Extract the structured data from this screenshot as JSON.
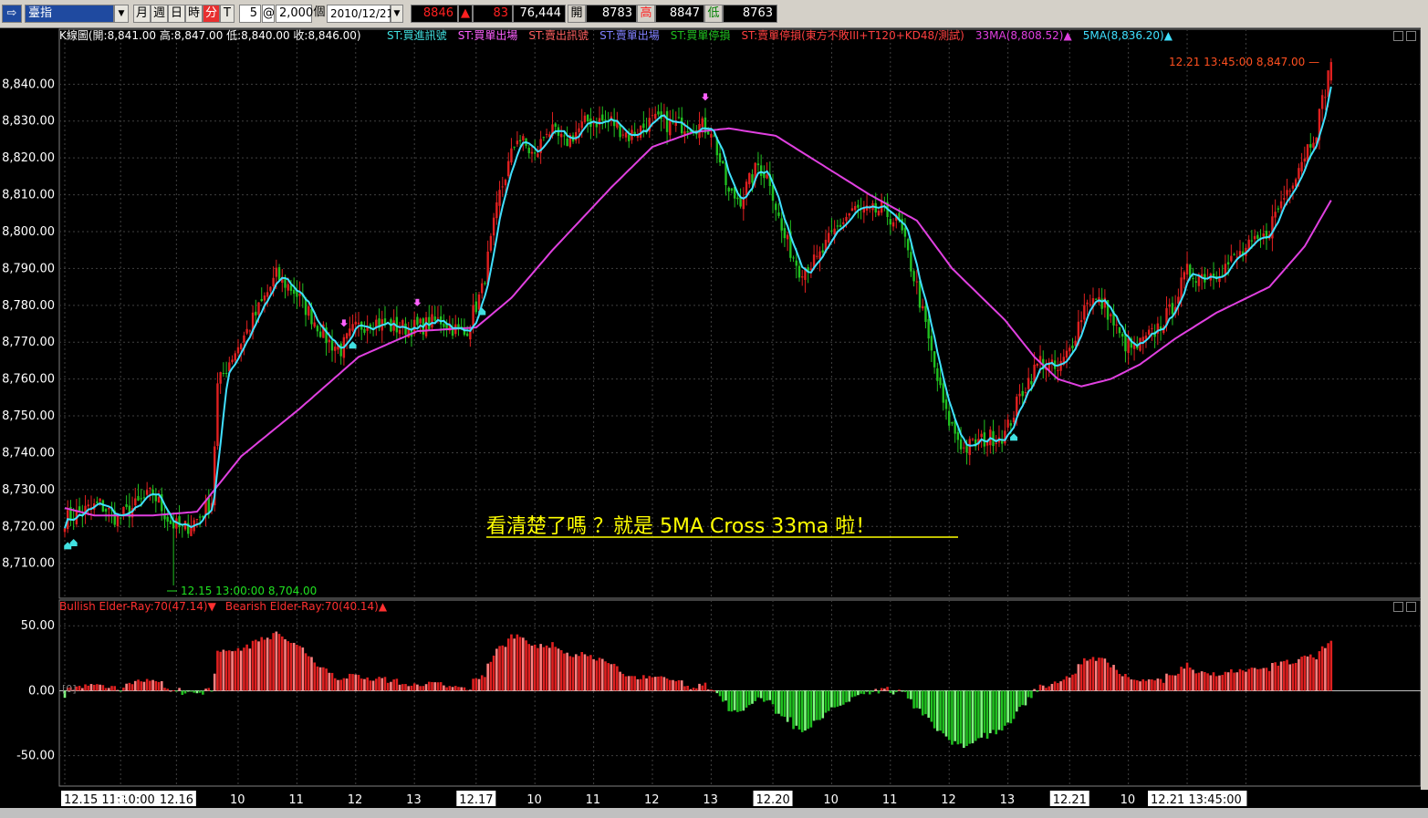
{
  "toolbar": {
    "symbol": "臺指",
    "periods": [
      "月",
      "週",
      "日",
      "時",
      "分",
      "T"
    ],
    "interval": "5",
    "at": "@",
    "qty": "2,000",
    "qty_unit": "個",
    "date": "2010/12/21",
    "last": "8846",
    "change_arrow": "▲",
    "change": "83",
    "volume": "76,444",
    "open_label": "開",
    "open": "8783",
    "high_label": "高",
    "high": "8847",
    "low_label": "低",
    "low": "8763"
  },
  "legend": {
    "kline": "K線圖(開:8,841.00 高:8,847.00 低:8,840.00 收:8,846.00)",
    "items": [
      {
        "text": "ST:買進訊號",
        "color": "#40e0e0"
      },
      {
        "text": "ST:買單出場",
        "color": "#ff60ff"
      },
      {
        "text": "ST:賣出訊號",
        "color": "#ff6060"
      },
      {
        "text": "ST:賣單出場",
        "color": "#8080ff"
      },
      {
        "text": "ST:買單停損",
        "color": "#20c020"
      },
      {
        "text": "ST:賣單停損(東方不敗III+T120+KD48/測試)",
        "color": "#ff4040"
      },
      {
        "text": "33MA(8,808.52)▲",
        "color": "#e040e0"
      },
      {
        "text": "5MA(8,836.20)▲",
        "color": "#40e0ff"
      }
    ],
    "sub": [
      {
        "text": "Bullish Elder-Ray:70(47.14)▼",
        "color": "#ff3030"
      },
      {
        "text": "Bearish Elder-Ray:70(40.14)▲",
        "color": "#ff3030"
      }
    ],
    "zero_marker": "[0]"
  },
  "annotations": {
    "high_label": "12.21 13:45:00  8,847.00 —",
    "low_label": "12.15 13:00:00  8,704.00",
    "caption": "看清楚了嗎 ？就是  5MA Cross 33ma 啦！"
  },
  "colors": {
    "up": "#e02020",
    "down": "#20c020",
    "ma33": "#e040e0",
    "ma5": "#40e0ff",
    "grid": "#404040",
    "caption": "#ffff00"
  },
  "chart_data": {
    "type": "candlestick",
    "y_axis": {
      "range": [
        8703,
        8848
      ],
      "ticks": [
        "8,710.00",
        "8,720.00",
        "8,730.00",
        "8,740.00",
        "8,750.00",
        "8,760.00",
        "8,770.00",
        "8,780.00",
        "8,790.00",
        "8,800.00",
        "8,810.00",
        "8,820.00",
        "8,830.00",
        "8,840.00"
      ],
      "tick_values": [
        8710,
        8720,
        8730,
        8740,
        8750,
        8760,
        8770,
        8780,
        8790,
        8800,
        8810,
        8820,
        8830,
        8840
      ]
    },
    "x_axis": {
      "labels": [
        "12.15 11:10:00",
        "13",
        "12.16",
        "10",
        "11",
        "12",
        "13",
        "12.17",
        "10",
        "11",
        "12",
        "13",
        "12.20",
        "10",
        "11",
        "12",
        "13",
        "12.21",
        "10",
        "11",
        "12.21 13:45:00"
      ],
      "label_index": [
        0,
        19,
        38,
        59,
        79,
        99,
        119,
        140,
        160,
        180,
        200,
        220,
        241,
        261,
        281,
        301,
        321,
        342,
        362,
        382,
        402
      ]
    },
    "anchors_close": [
      [
        0,
        8722
      ],
      [
        12,
        8726
      ],
      [
        18,
        8722
      ],
      [
        30,
        8729
      ],
      [
        36,
        8721
      ],
      [
        40,
        8719
      ],
      [
        45,
        8722
      ],
      [
        50,
        8727
      ],
      [
        52,
        8758
      ],
      [
        56,
        8765
      ],
      [
        62,
        8773
      ],
      [
        72,
        8788
      ],
      [
        78,
        8784
      ],
      [
        90,
        8770
      ],
      [
        94,
        8768
      ],
      [
        98,
        8773
      ],
      [
        104,
        8776
      ],
      [
        112,
        8774
      ],
      [
        120,
        8774
      ],
      [
        128,
        8776
      ],
      [
        136,
        8772
      ],
      [
        142,
        8784
      ],
      [
        148,
        8810
      ],
      [
        154,
        8826
      ],
      [
        160,
        8820
      ],
      [
        164,
        8828
      ],
      [
        170,
        8824
      ],
      [
        178,
        8830
      ],
      [
        186,
        8830
      ],
      [
        192,
        8826
      ],
      [
        200,
        8830
      ],
      [
        208,
        8829
      ],
      [
        214,
        8829
      ],
      [
        220,
        8828
      ],
      [
        226,
        8810
      ],
      [
        230,
        8809
      ],
      [
        236,
        8818
      ],
      [
        240,
        8814
      ],
      [
        244,
        8800
      ],
      [
        250,
        8790
      ],
      [
        256,
        8792
      ],
      [
        262,
        8800
      ],
      [
        268,
        8806
      ],
      [
        274,
        8805
      ],
      [
        278,
        8806
      ],
      [
        284,
        8802
      ],
      [
        290,
        8785
      ],
      [
        296,
        8763
      ],
      [
        300,
        8750
      ],
      [
        306,
        8741
      ],
      [
        314,
        8744
      ],
      [
        320,
        8745
      ],
      [
        326,
        8757
      ],
      [
        332,
        8765
      ],
      [
        338,
        8762
      ],
      [
        342,
        8768
      ],
      [
        348,
        8782
      ],
      [
        354,
        8780
      ],
      [
        360,
        8770
      ],
      [
        364,
        8768
      ],
      [
        370,
        8772
      ],
      [
        376,
        8778
      ],
      [
        382,
        8789
      ],
      [
        388,
        8788
      ],
      [
        394,
        8790
      ],
      [
        402,
        8795
      ],
      [
        408,
        8798
      ],
      [
        414,
        8808
      ],
      [
        420,
        8818
      ],
      [
        426,
        8828
      ],
      [
        431,
        8846
      ]
    ],
    "anchors_ma33": [
      [
        0,
        8725
      ],
      [
        10,
        8723
      ],
      [
        30,
        8723
      ],
      [
        45,
        8724
      ],
      [
        60,
        8739
      ],
      [
        80,
        8752
      ],
      [
        100,
        8766
      ],
      [
        120,
        8773
      ],
      [
        140,
        8774
      ],
      [
        152,
        8782
      ],
      [
        166,
        8795
      ],
      [
        186,
        8812
      ],
      [
        200,
        8823
      ],
      [
        214,
        8827
      ],
      [
        226,
        8828
      ],
      [
        242,
        8826
      ],
      [
        258,
        8818
      ],
      [
        274,
        8810
      ],
      [
        290,
        8803
      ],
      [
        302,
        8790
      ],
      [
        320,
        8776
      ],
      [
        330,
        8766
      ],
      [
        338,
        8760
      ],
      [
        346,
        8758
      ],
      [
        356,
        8760
      ],
      [
        366,
        8764
      ],
      [
        378,
        8771
      ],
      [
        392,
        8778
      ],
      [
        410,
        8785
      ],
      [
        422,
        8796
      ],
      [
        431,
        8808.52
      ]
    ],
    "markers": [
      {
        "i": 1,
        "type": "buy"
      },
      {
        "i": 3,
        "type": "buy"
      },
      {
        "i": 95,
        "type": "exit"
      },
      {
        "i": 98,
        "type": "buy"
      },
      {
        "i": 120,
        "type": "exit"
      },
      {
        "i": 142,
        "type": "buy"
      },
      {
        "i": 218,
        "type": "exit"
      },
      {
        "i": 323,
        "type": "buy"
      }
    ],
    "elder_ray": {
      "y_range": [
        -72,
        60
      ],
      "ticks": [
        "50.00",
        "0.00",
        "-50.00"
      ],
      "tick_values": [
        50,
        0,
        -50
      ]
    },
    "count": 432
  }
}
